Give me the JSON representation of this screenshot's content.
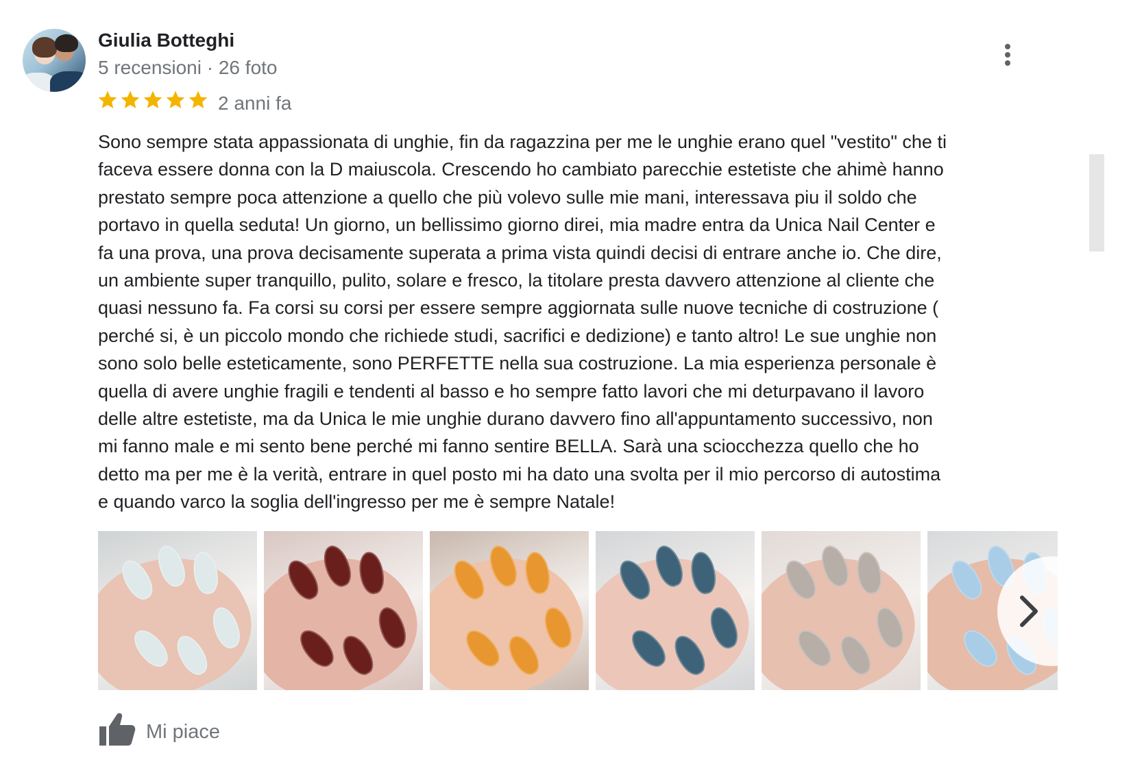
{
  "review": {
    "author": {
      "name": "Giulia Botteghi",
      "meta": "5 recensioni · 26 foto",
      "avatar_icon": "user-avatar"
    },
    "rating": {
      "value": 5,
      "max": 5,
      "star_color": "#f4b400"
    },
    "time": "2 anni fa",
    "text": "Sono sempre stata appassionata di unghie, fin da ragazzina per me le unghie erano quel \"vestito\" che ti\nfaceva essere donna con la D maiuscola. Crescendo ho cambiato parecchie estetiste che ahimè hanno\nprestato sempre poca attenzione a quello che più volevo sulle mie mani, interessava piu il soldo che\nportavo in quella seduta! Un giorno, un bellissimo giorno direi, mia madre entra da Unica Nail Center e\nfa una prova, una prova decisamente superata a prima vista quindi decisi di entrare anche io. Che dire,\nun ambiente super tranquillo,  pulito, solare e fresco, la titolare presta davvero attenzione al cliente che\nquasi nessuno fa. Fa corsi su corsi per essere sempre aggiornata sulle nuove tecniche di costruzione (\nperché si, è un piccolo mondo che richiede studi, sacrifici e dedizione) e tanto altro! Le sue unghie non\nsono solo belle esteticamente, sono PERFETTE nella sua costruzione. La mia esperienza personale è\nquella di avere unghie fragili e tendenti al basso e ho sempre fatto lavori che mi deturpavano il lavoro\ndelle altre estetiste, ma da Unica le mie unghie durano davvero fino all'appuntamento successivo, non\nmi fanno male e mi sento bene perché mi fanno sentire BELLA. Sarà una sciocchezza quello che ho\ndetto ma per me è la verità,  entrare in quel posto mi ha dato una svolta per il mio percorso di autostima\ne quando varco la soglia dell'ingresso per me è sempre Natale!",
    "photos": [
      {
        "bg": "#cfd3d4",
        "skin": "#e9c3b3",
        "nail": "#dfe9ea"
      },
      {
        "bg": "#d9c7c2",
        "skin": "#e4b4a6",
        "nail": "#6b1f1c"
      },
      {
        "bg": "#c9b8ad",
        "skin": "#efc3a9",
        "nail": "#e8962f"
      },
      {
        "bg": "#d4d6d8",
        "skin": "#ecc6b8",
        "nail": "#3e6378"
      },
      {
        "bg": "#e2dad6",
        "skin": "#e8c0b0",
        "nail": "#b7aea8"
      },
      {
        "bg": "#d8dadc",
        "skin": "#e6bca8",
        "nail": "#a9cde6"
      }
    ],
    "icons": {
      "menu": "more-vert-icon",
      "next": "chevron-right-icon",
      "like": "thumbs-up-icon"
    },
    "like_label": "Mi piace"
  }
}
